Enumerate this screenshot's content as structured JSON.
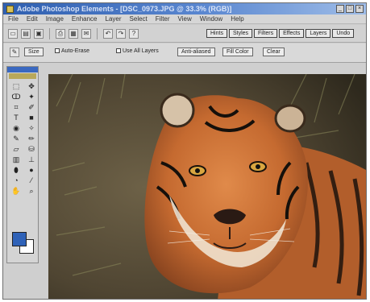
{
  "window": {
    "title": "Adobe Photoshop Elements - [DSC_0973.JPG @ 33.3% (RGB)]"
  },
  "menubar": {
    "items": [
      "File",
      "Edit",
      "Image",
      "Enhance",
      "Layer",
      "Select",
      "Filter",
      "View",
      "Window",
      "Help"
    ]
  },
  "toolbar": {
    "tabs": [
      "Hints",
      "Styles",
      "Filters",
      "Effects",
      "Layers",
      "Undo"
    ]
  },
  "options": {
    "tool_size": "Size",
    "check1_label": "Auto-Erase",
    "check2_label": "Use All Layers",
    "button1": "Anti-aliased",
    "button2": "Fill Color",
    "button3": "Clear"
  },
  "colors": {
    "foreground": "#2f62b8",
    "background": "#ffffff"
  },
  "icons": [
    "new-icon",
    "open-icon",
    "save-icon",
    "print-icon",
    "undo-icon",
    "redo-icon",
    "help-icon"
  ]
}
